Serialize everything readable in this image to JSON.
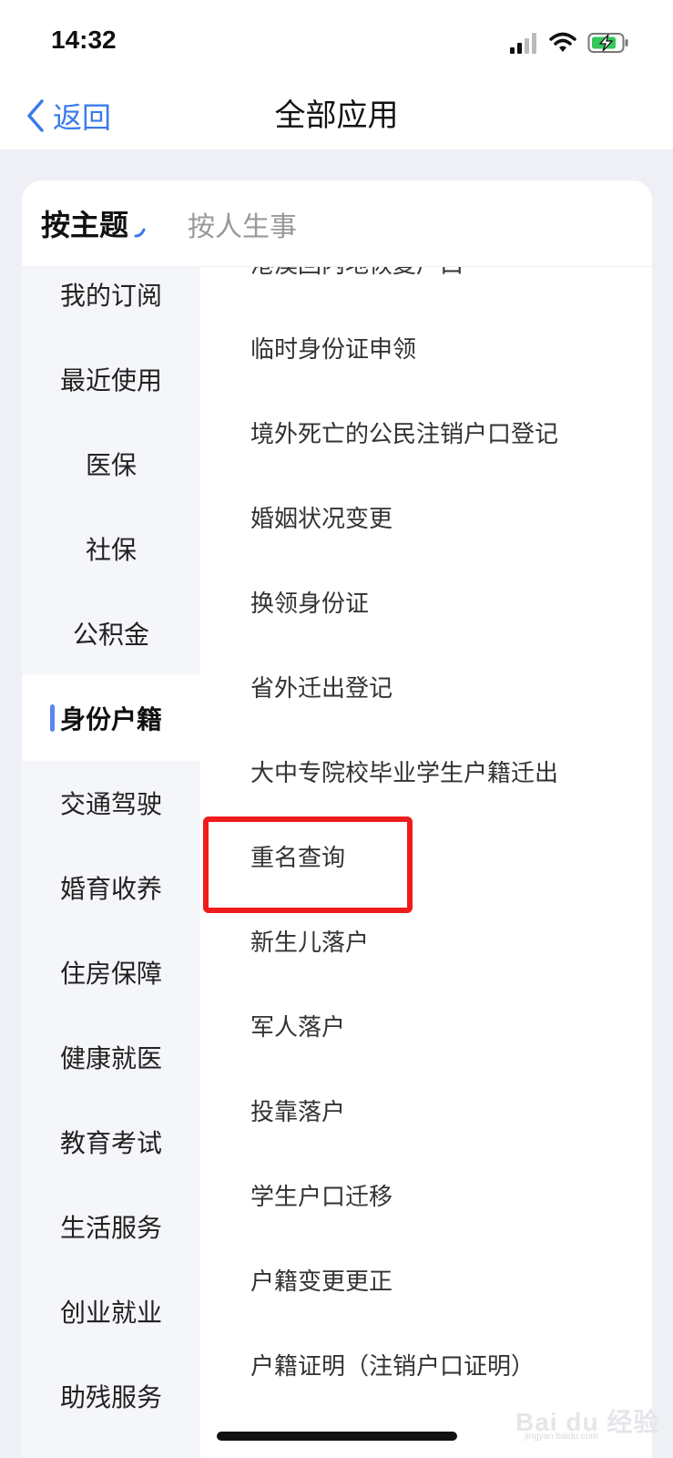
{
  "status_bar": {
    "time": "14:32",
    "icons": [
      "signal-icon",
      "wifi-icon",
      "battery-charging-icon"
    ]
  },
  "nav": {
    "back_label": "返回",
    "title": "全部应用"
  },
  "tabs": [
    {
      "label": "按主题",
      "active": true
    },
    {
      "label": "按人生事",
      "active": false
    }
  ],
  "sidebar": {
    "items": [
      {
        "label": "我的订阅"
      },
      {
        "label": "最近使用"
      },
      {
        "label": "医保"
      },
      {
        "label": "社保"
      },
      {
        "label": "公积金"
      },
      {
        "label": "身份户籍",
        "active": true
      },
      {
        "label": "交通驾驶"
      },
      {
        "label": "婚育收养"
      },
      {
        "label": "住房保障"
      },
      {
        "label": "健康就医"
      },
      {
        "label": "教育考试"
      },
      {
        "label": "生活服务"
      },
      {
        "label": "创业就业"
      },
      {
        "label": "助残服务"
      }
    ]
  },
  "content": {
    "items": [
      {
        "label": "港澳回内地恢复户口"
      },
      {
        "label": "临时身份证申领"
      },
      {
        "label": "境外死亡的公民注销户口登记"
      },
      {
        "label": "婚姻状况变更"
      },
      {
        "label": "换领身份证"
      },
      {
        "label": "省外迁出登记"
      },
      {
        "label": "大中专院校毕业学生户籍迁出"
      },
      {
        "label": "重名查询",
        "highlighted": true
      },
      {
        "label": "新生儿落户"
      },
      {
        "label": "军人落户"
      },
      {
        "label": "投靠落户"
      },
      {
        "label": "学生户口迁移"
      },
      {
        "label": "户籍变更更正"
      },
      {
        "label": "户籍证明（注销户口证明）"
      }
    ]
  },
  "colors": {
    "accent": "#3a7bea",
    "highlight": "#ee1c1c",
    "active_indicator": "#5a86f0"
  },
  "watermark": {
    "text": "Bai du 经验",
    "sub": "jingyan.baidu.com"
  }
}
